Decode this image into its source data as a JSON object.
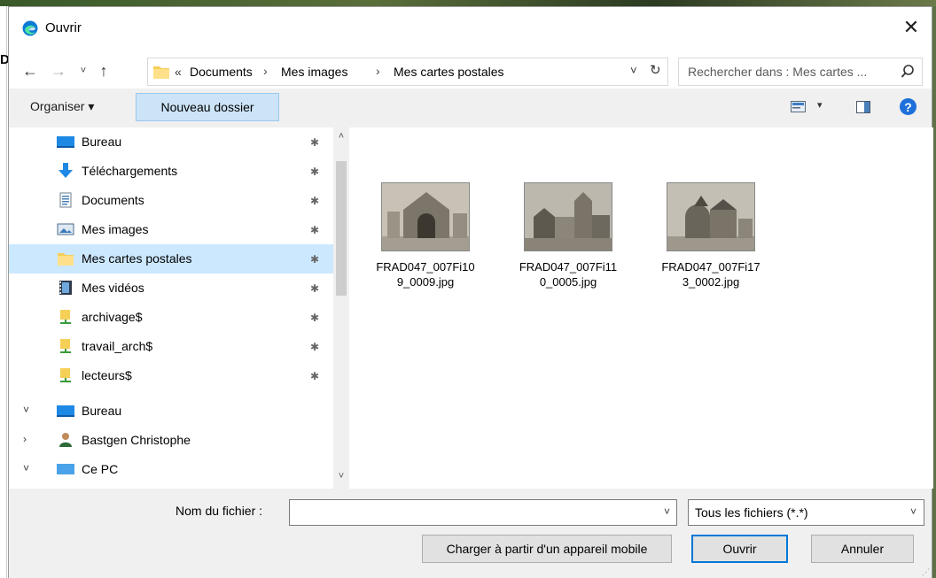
{
  "window": {
    "title": "Ouvrir",
    "close_glyph": "✕",
    "background_left_char": "D"
  },
  "nav": {
    "back_glyph": "←",
    "forward_glyph": "→",
    "recent_glyph": "˅",
    "up_glyph": "↑",
    "breadcrumb_chevron": "«",
    "breadcrumbs": [
      "Documents",
      "Mes images",
      "Mes cartes postales"
    ],
    "separator": "›",
    "dropdown_glyph": "˅",
    "refresh_glyph": "↻"
  },
  "search": {
    "placeholder": "Rechercher dans : Mes cartes ..."
  },
  "toolbar": {
    "organise_label": "Organiser ▾",
    "new_folder_label": "Nouveau dossier",
    "view_dropdown_glyph": "▾",
    "help_glyph": "?"
  },
  "sidebar": {
    "quick_access": [
      {
        "label": "Bureau",
        "icon": "desktop-icon"
      },
      {
        "label": "Téléchargements",
        "icon": "download-icon"
      },
      {
        "label": "Documents",
        "icon": "documents-icon"
      },
      {
        "label": "Mes images",
        "icon": "pictures-icon"
      },
      {
        "label": "Mes cartes postales",
        "icon": "folder-icon",
        "selected": true
      },
      {
        "label": "Mes vidéos",
        "icon": "videos-icon"
      },
      {
        "label": "archivage$",
        "icon": "network-folder-icon"
      },
      {
        "label": "travail_arch$",
        "icon": "network-folder-icon"
      },
      {
        "label": "lecteurs$",
        "icon": "network-folder-icon"
      }
    ],
    "tree": [
      {
        "label": "Bureau",
        "expander": "˅",
        "icon": "desktop-icon"
      },
      {
        "label": "Bastgen Christophe",
        "expander": "›",
        "icon": "user-icon"
      },
      {
        "label": "Ce PC",
        "expander": "˅",
        "icon": "pc-icon"
      }
    ],
    "pin_glyph": "✱",
    "scroll_up_glyph": "˄",
    "scroll_down_glyph": "˅"
  },
  "files": [
    {
      "name": "FRAD047_007Fi10\n9_0009.jpg",
      "line1": "FRAD047_007Fi10",
      "line2": "9_0009.jpg"
    },
    {
      "name": "FRAD047_007Fi11\n0_0005.jpg",
      "line1": "FRAD047_007Fi11",
      "line2": "0_0005.jpg"
    },
    {
      "name": "FRAD047_007Fi17\n3_0002.jpg",
      "line1": "FRAD047_007Fi17",
      "line2": "3_0002.jpg"
    }
  ],
  "footer": {
    "filename_label": "Nom du fichier :",
    "filename_value": "",
    "filename_dropdown_glyph": "˅",
    "filter_value": "Tous les fichiers (*.*)",
    "filter_dropdown_glyph": "˅",
    "mobile_button": "Charger à partir d'un appareil mobile",
    "open_button": "Ouvrir",
    "cancel_button": "Annuler",
    "grip_glyph": "⋰"
  },
  "colors": {
    "selection": "#cce8ff",
    "toolbar_bg": "#f0f0f0",
    "accent": "#0078d7",
    "new_folder_bg": "#cce4f7"
  }
}
